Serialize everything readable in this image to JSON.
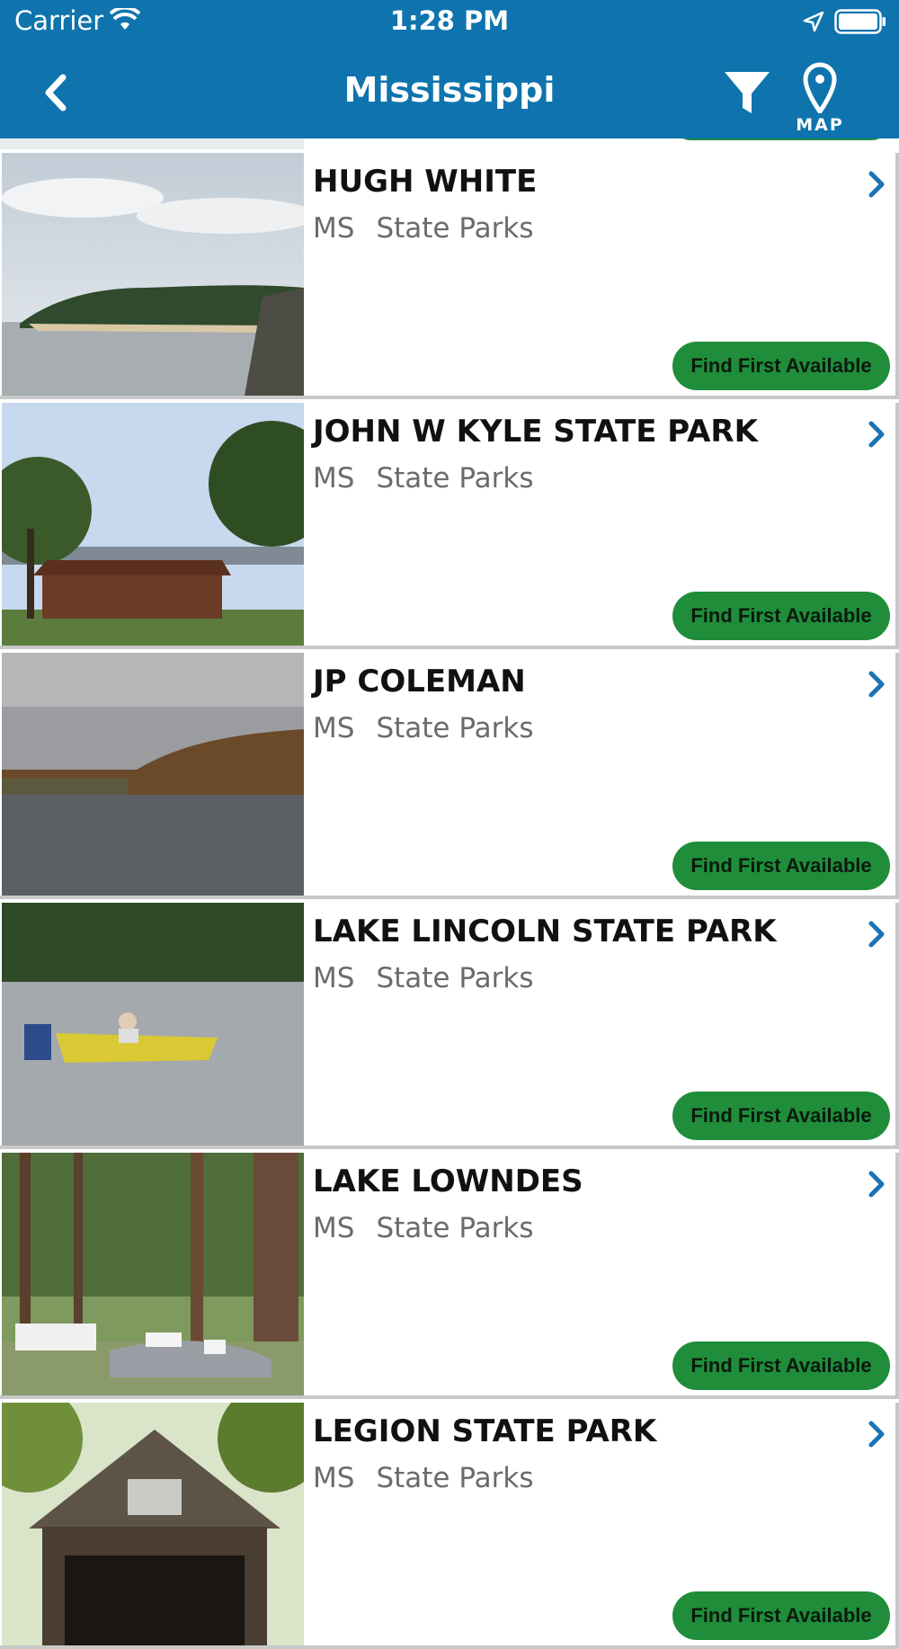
{
  "status_bar": {
    "carrier": "Carrier",
    "time": "1:28 PM"
  },
  "nav": {
    "title": "Mississippi",
    "map_label": "MAP"
  },
  "colors": {
    "bar": "#0f74ad",
    "button": "#1f8d3a",
    "chevron": "#1a73b5"
  },
  "parks": [
    {
      "name": "HUGH WHITE",
      "state": "MS",
      "category": "State Parks",
      "action": "Find First Available"
    },
    {
      "name": "JOHN W KYLE STATE PARK",
      "state": "MS",
      "category": "State Parks",
      "action": "Find First Available"
    },
    {
      "name": "JP COLEMAN",
      "state": "MS",
      "category": "State Parks",
      "action": "Find First Available"
    },
    {
      "name": "LAKE LINCOLN STATE PARK",
      "state": "MS",
      "category": "State Parks",
      "action": "Find First Available"
    },
    {
      "name": "LAKE LOWNDES",
      "state": "MS",
      "category": "State Parks",
      "action": "Find First Available"
    },
    {
      "name": "LEGION STATE PARK",
      "state": "MS",
      "category": "State Parks",
      "action": "Find First Available"
    }
  ]
}
